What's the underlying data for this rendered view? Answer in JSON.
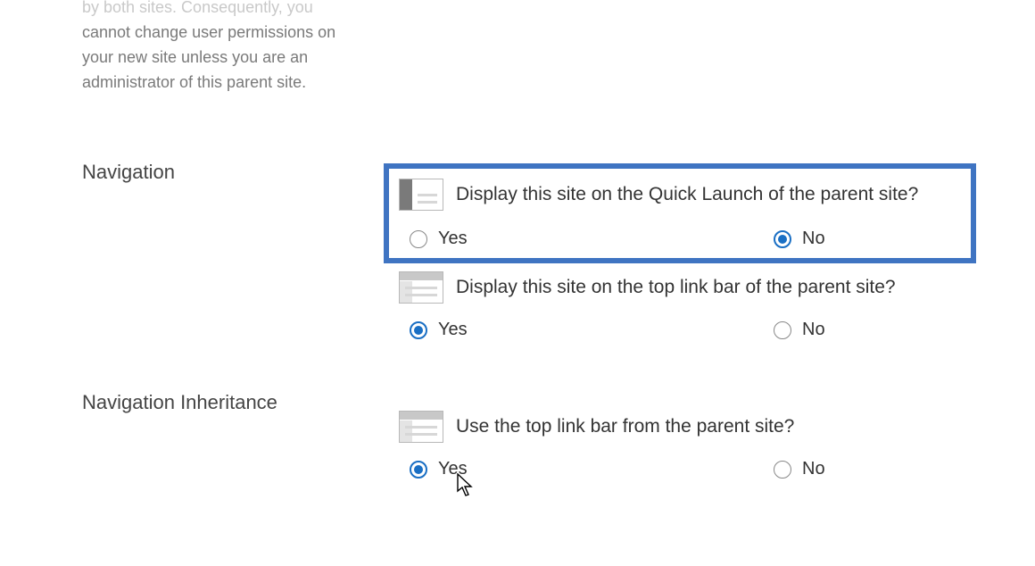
{
  "permissions": {
    "description_line0": "by both sites. Consequently, you",
    "description_rest": "cannot change user permissions on your new site unless you are an administrator of this parent site."
  },
  "navigation": {
    "section_label": "Navigation",
    "quick_launch": {
      "question": "Display this site on the Quick Launch of the parent site?",
      "yes": "Yes",
      "no": "No",
      "selected": "No"
    },
    "top_link_bar": {
      "question": "Display this site on the top link bar of the parent site?",
      "yes": "Yes",
      "no": "No",
      "selected": "Yes"
    }
  },
  "inheritance": {
    "section_label": "Navigation Inheritance",
    "top_link_bar_parent": {
      "question": "Use the top link bar from the parent site?",
      "yes": "Yes",
      "no": "No",
      "selected": "Yes"
    }
  },
  "colors": {
    "highlight_border": "#3f74c2",
    "selected_radio": "#1a6fc4"
  }
}
